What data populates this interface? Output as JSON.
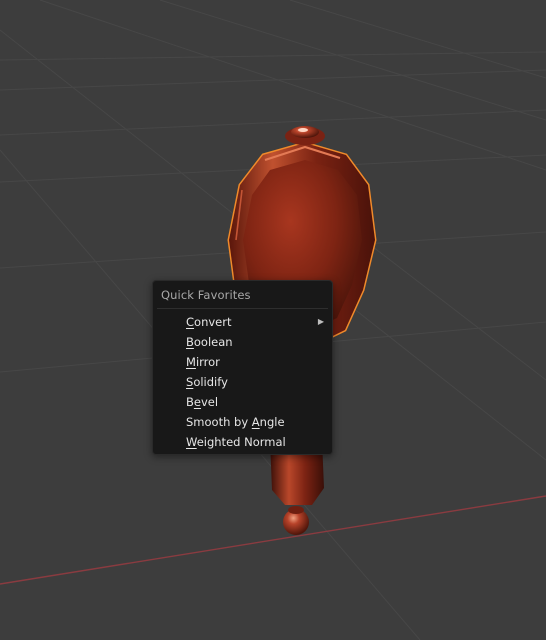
{
  "menu": {
    "title": "Quick Favorites",
    "items": [
      {
        "pre": "",
        "key": "C",
        "post": "onvert",
        "submenu": true
      },
      {
        "pre": "",
        "key": "B",
        "post": "oolean",
        "submenu": false
      },
      {
        "pre": "",
        "key": "M",
        "post": "irror",
        "submenu": false
      },
      {
        "pre": "",
        "key": "S",
        "post": "olidify",
        "submenu": false
      },
      {
        "pre": "B",
        "key": "e",
        "post": "vel",
        "submenu": false
      },
      {
        "pre": "Smooth by ",
        "key": "A",
        "post": "ngle",
        "submenu": false
      },
      {
        "pre": "",
        "key": "W",
        "post": "eighted Normal",
        "submenu": false
      }
    ],
    "submenu_arrow": "▶"
  },
  "colors": {
    "viewport_bg": "#3d3d3d",
    "grid_line": "#4a4a4a",
    "x_axis": "#8a3b40",
    "object_base": "#8b2614",
    "object_highlight": "#d5623f",
    "selection_outline": "#f08a2a",
    "menu_bg": "#181818",
    "menu_text": "#e6e6e6",
    "menu_title": "#a8a8a8"
  },
  "icons": {
    "submenu": "chevron-right-icon"
  }
}
